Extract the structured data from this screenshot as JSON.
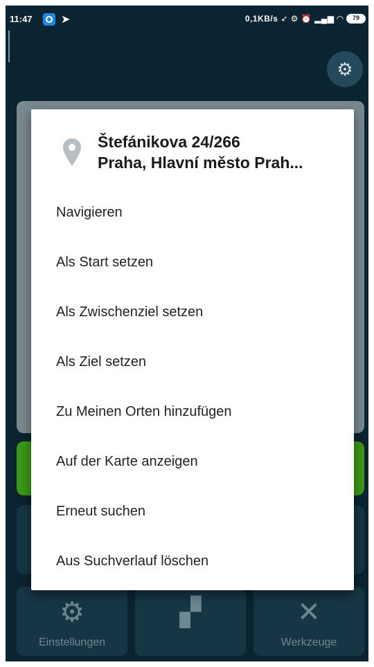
{
  "status_bar": {
    "time": "11:47",
    "network": "0,1KB/s",
    "battery": "79"
  },
  "dialog": {
    "address_line1": "Štefánikova 24/266",
    "address_line2": "Praha, Hlavní město Prah...",
    "menu": [
      "Navigieren",
      "Als Start setzen",
      "Als Zwischenziel setzen",
      "Als Ziel setzen",
      "Zu Meinen Orten hinzufügen",
      "Auf der Karte anzeigen",
      "Erneut suchen",
      "Aus Suchverlauf löschen"
    ]
  },
  "background": {
    "tiles": {
      "settings": "Einstellungen",
      "tools": "Werkzeuge"
    }
  },
  "colors": {
    "background": "#0b2431",
    "dialog": "#ffffff",
    "green_button": "#3b9a18",
    "pin": "#b8bec2"
  }
}
